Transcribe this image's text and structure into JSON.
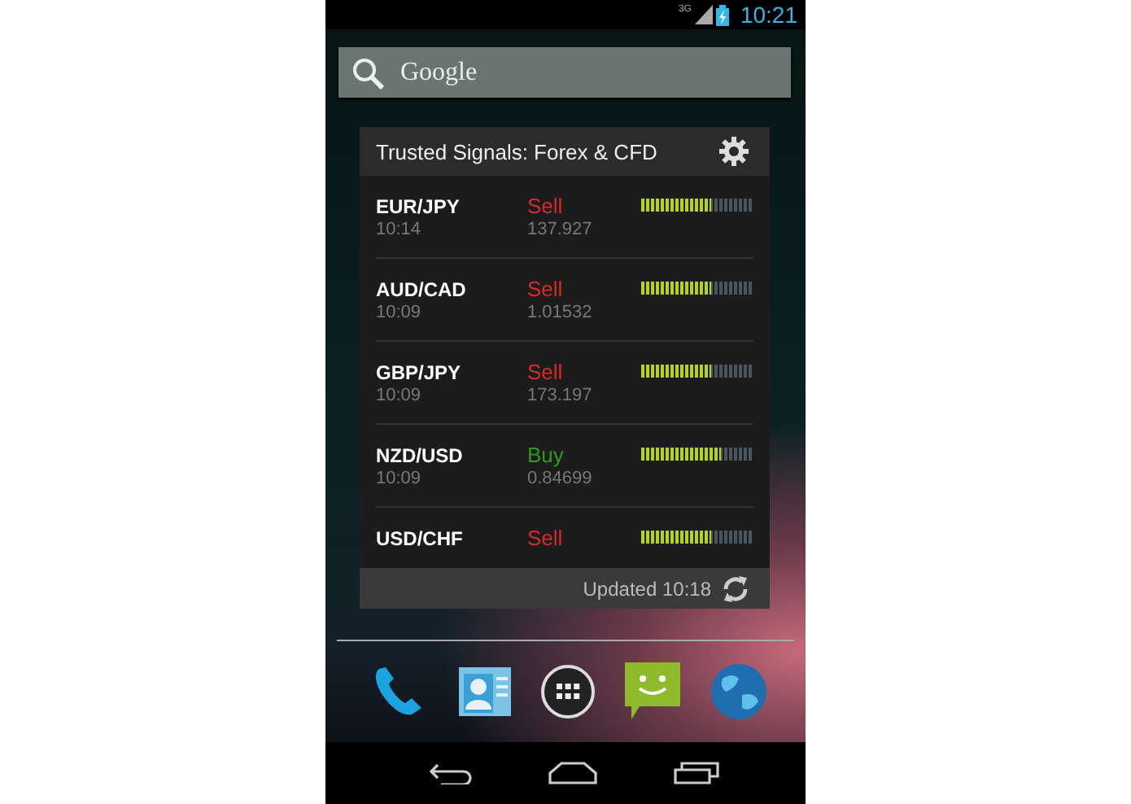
{
  "status_bar": {
    "network": "3G",
    "time": "10:21"
  },
  "search": {
    "placeholder": "Google"
  },
  "widget": {
    "title": "Trusted Signals: Forex & CFD",
    "rows": [
      {
        "pair": "EUR/JPY",
        "time": "10:14",
        "kind": "sell",
        "signal": "Sell",
        "price": "137.927",
        "level": 0.62
      },
      {
        "pair": "AUD/CAD",
        "time": "10:09",
        "kind": "sell",
        "signal": "Sell",
        "price": "1.01532",
        "level": 0.62
      },
      {
        "pair": "GBP/JPY",
        "time": "10:09",
        "kind": "sell",
        "signal": "Sell",
        "price": "173.197",
        "level": 0.62
      },
      {
        "pair": "NZD/USD",
        "time": "10:09",
        "kind": "buy",
        "signal": "Buy",
        "price": "0.84699",
        "level": 0.71
      },
      {
        "pair": "USD/CHF",
        "kind": "sell",
        "signal": "Sell",
        "level": 0.62
      }
    ],
    "footer": "Updated 10:18"
  },
  "dock": [
    {
      "kind": "phone"
    },
    {
      "kind": "contacts"
    },
    {
      "kind": "apps"
    },
    {
      "kind": "messaging"
    },
    {
      "kind": "browser"
    }
  ],
  "nav": [
    {
      "kind": "back"
    },
    {
      "kind": "home"
    },
    {
      "kind": "recents"
    }
  ]
}
